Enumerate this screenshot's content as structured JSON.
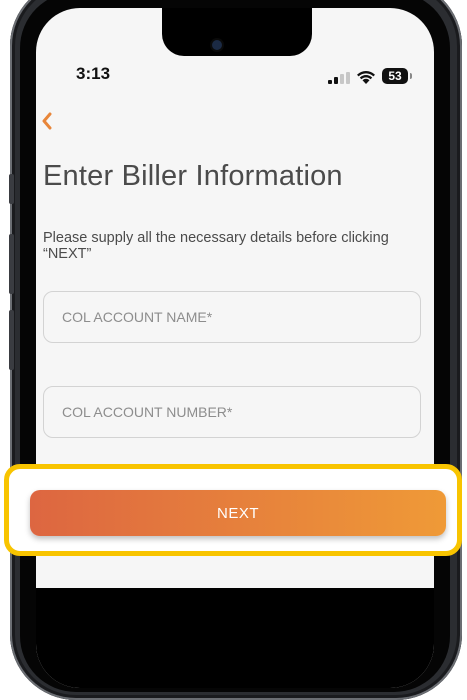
{
  "status_bar": {
    "time": "3:13",
    "battery": "53"
  },
  "screen": {
    "back_icon": "chevron-left-icon",
    "title": "Enter Biller Information",
    "instructions": "Please supply all the necessary details before clicking “NEXT”",
    "fields": [
      {
        "placeholder": "COL ACCOUNT NAME*",
        "value": ""
      },
      {
        "placeholder": "COL ACCOUNT NUMBER*",
        "value": ""
      }
    ],
    "next_label": "NEXT"
  },
  "colors": {
    "accent": "#e8863a",
    "button_gradient_start": "#dd6641",
    "button_gradient_end": "#ef9a37",
    "highlight": "#f8c400",
    "text": "#4b4b4b"
  }
}
